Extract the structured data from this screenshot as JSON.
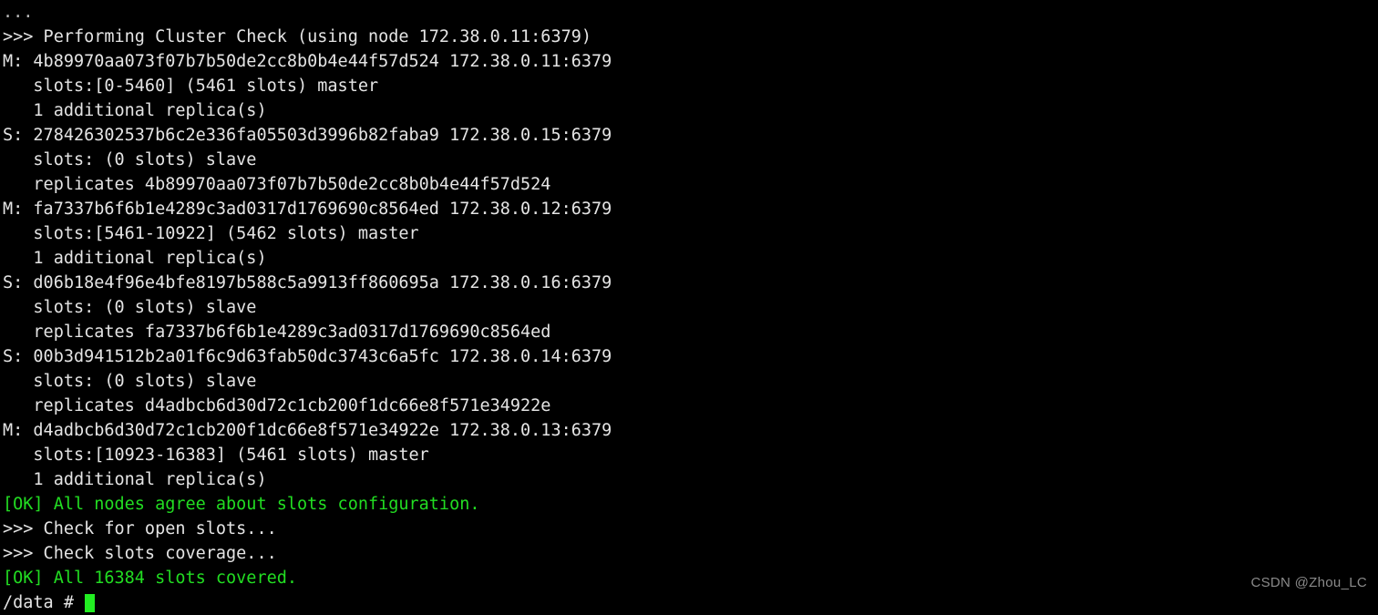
{
  "terminal": {
    "background_color": "#000000",
    "foreground_color": "#e4e4e4",
    "ok_color": "#22dd22",
    "cursor_color": "#22ee22",
    "lines": [
      {
        "text": "...",
        "color": "dim"
      },
      {
        "text": ">>> Performing Cluster Check (using node 172.38.0.11:6379)",
        "color": "white"
      },
      {
        "text": "M: 4b89970aa073f07b7b50de2cc8b0b4e44f57d524 172.38.0.11:6379",
        "color": "white"
      },
      {
        "text": "   slots:[0-5460] (5461 slots) master",
        "color": "white"
      },
      {
        "text": "   1 additional replica(s)",
        "color": "white"
      },
      {
        "text": "S: 278426302537b6c2e336fa05503d3996b82faba9 172.38.0.15:6379",
        "color": "white"
      },
      {
        "text": "   slots: (0 slots) slave",
        "color": "white"
      },
      {
        "text": "   replicates 4b89970aa073f07b7b50de2cc8b0b4e44f57d524",
        "color": "white"
      },
      {
        "text": "M: fa7337b6f6b1e4289c3ad0317d1769690c8564ed 172.38.0.12:6379",
        "color": "white"
      },
      {
        "text": "   slots:[5461-10922] (5462 slots) master",
        "color": "white"
      },
      {
        "text": "   1 additional replica(s)",
        "color": "white"
      },
      {
        "text": "S: d06b18e4f96e4bfe8197b588c5a9913ff860695a 172.38.0.16:6379",
        "color": "white"
      },
      {
        "text": "   slots: (0 slots) slave",
        "color": "white"
      },
      {
        "text": "   replicates fa7337b6f6b1e4289c3ad0317d1769690c8564ed",
        "color": "white"
      },
      {
        "text": "S: 00b3d941512b2a01f6c9d63fab50dc3743c6a5fc 172.38.0.14:6379",
        "color": "white"
      },
      {
        "text": "   slots: (0 slots) slave",
        "color": "white"
      },
      {
        "text": "   replicates d4adbcb6d30d72c1cb200f1dc66e8f571e34922e",
        "color": "white"
      },
      {
        "text": "M: d4adbcb6d30d72c1cb200f1dc66e8f571e34922e 172.38.0.13:6379",
        "color": "white"
      },
      {
        "text": "   slots:[10923-16383] (5461 slots) master",
        "color": "white"
      },
      {
        "text": "   1 additional replica(s)",
        "color": "white"
      },
      {
        "text": "[OK] All nodes agree about slots configuration.",
        "color": "green"
      },
      {
        "text": ">>> Check for open slots...",
        "color": "white"
      },
      {
        "text": ">>> Check slots coverage...",
        "color": "white"
      },
      {
        "text": "[OK] All 16384 slots covered.",
        "color": "green"
      }
    ],
    "prompt": {
      "text": "/data # ",
      "cursor": "block"
    }
  },
  "watermark": {
    "text": "CSDN @Zhou_LC"
  }
}
